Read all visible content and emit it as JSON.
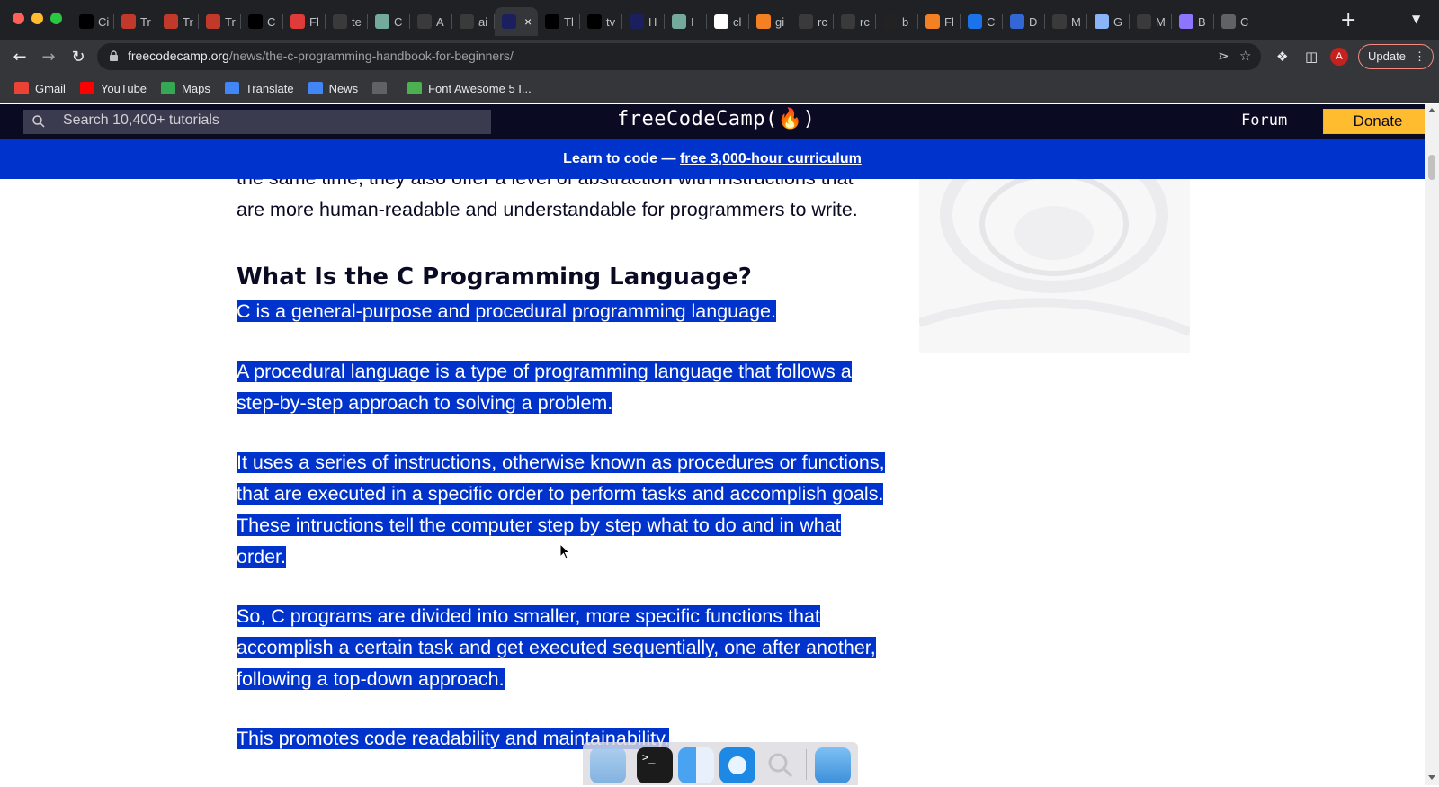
{
  "tabs": [
    {
      "title": "Ci",
      "icon": "terminal-icon",
      "color": "#000000"
    },
    {
      "title": "Tr",
      "icon": "red-square-icon",
      "color": "#c0392b"
    },
    {
      "title": "Tr",
      "icon": "red-square-icon",
      "color": "#c0392b"
    },
    {
      "title": "Tr",
      "icon": "red-square-icon",
      "color": "#c0392b"
    },
    {
      "title": "C",
      "icon": "terminal-icon",
      "color": "#000000"
    },
    {
      "title": "Fl",
      "icon": "target-icon",
      "color": "#e03b3b"
    },
    {
      "title": "te",
      "icon": "github-icon",
      "color": "#3a3a3a"
    },
    {
      "title": "C",
      "icon": "chatgpt-icon",
      "color": "#74aa9c"
    },
    {
      "title": "A",
      "icon": "github-icon",
      "color": "#3a3a3a"
    },
    {
      "title": "ai",
      "icon": "github-icon",
      "color": "#3a3a3a"
    },
    {
      "title": "",
      "icon": "lambda-icon",
      "color": "#1b1f5e",
      "active": true
    },
    {
      "title": "Tl",
      "icon": "terminal-icon",
      "color": "#000000"
    },
    {
      "title": "tv",
      "icon": "x-icon",
      "color": "#000000"
    },
    {
      "title": "H",
      "icon": "lambda-icon",
      "color": "#1b1f5e"
    },
    {
      "title": "I",
      "icon": "chatgpt-icon",
      "color": "#74aa9c"
    },
    {
      "title": "cl",
      "icon": "google-icon",
      "color": "#ffffff"
    },
    {
      "title": "gi",
      "icon": "stackoverflow-icon",
      "color": "#f48024"
    },
    {
      "title": "rc",
      "icon": "github-icon",
      "color": "#3a3a3a"
    },
    {
      "title": "rc",
      "icon": "github-icon",
      "color": "#3a3a3a"
    },
    {
      "title": "b",
      "icon": "paw-icon",
      "color": "#222222"
    },
    {
      "title": "Fl",
      "icon": "stackoverflow-icon",
      "color": "#f48024"
    },
    {
      "title": "C",
      "icon": "headset-icon",
      "color": "#1a73e8"
    },
    {
      "title": "D",
      "icon": "badge-icon",
      "color": "#3367d6"
    },
    {
      "title": "M",
      "icon": "github-icon",
      "color": "#3a3a3a"
    },
    {
      "title": "G",
      "icon": "book-icon",
      "color": "#8ab4f8"
    },
    {
      "title": "M",
      "icon": "github-icon",
      "color": "#3a3a3a"
    },
    {
      "title": "B",
      "icon": "sparkle-icon",
      "color": "#8e75ff"
    },
    {
      "title": "C",
      "icon": "globe-icon",
      "color": "#5f6368"
    }
  ],
  "toolbar": {
    "url_host": "freecodecamp.org",
    "url_path": "/news/the-c-programming-handbook-for-beginners/",
    "update_label": "Update",
    "avatar_letter": "A"
  },
  "bookmarks": [
    {
      "label": "Gmail",
      "icon": "gmail-icon",
      "color": "#ea4335"
    },
    {
      "label": "YouTube",
      "icon": "youtube-icon",
      "color": "#ff0000"
    },
    {
      "label": "Maps",
      "icon": "maps-icon",
      "color": "#34a853"
    },
    {
      "label": "Translate",
      "icon": "translate-icon",
      "color": "#4285f4"
    },
    {
      "label": "News",
      "icon": "news-icon",
      "color": "#4285f4"
    },
    {
      "label": "",
      "icon": "globe-icon",
      "color": "#5f6368"
    },
    {
      "label": "Font Awesome 5 I...",
      "icon": "w-icon",
      "color": "#4caf50"
    }
  ],
  "fcc": {
    "search_placeholder": "Search 10,400+ tutorials",
    "logo": "freeCodeCamp(🔥)",
    "forum": "Forum",
    "donate": "Donate",
    "banner_prefix": "Learn to code — ",
    "banner_link": "free 3,000-hour curriculum"
  },
  "article": {
    "prev_line1": "the same time, they also offer a level of abstraction with instructions that",
    "prev_line2": "are more human-readable and understandable for programmers to write.",
    "heading": "What Is the C Programming Language?",
    "p1": [
      "C is a general-purpose and procedural programming language."
    ],
    "p2": [
      "A procedural language is a type of programming language that follows a",
      "step-by-step approach to solving a problem."
    ],
    "p3": [
      "It uses a series of instructions, otherwise known as procedures or functions,",
      "that are executed in a specific order to perform tasks and accomplish goals.",
      "These intructions tell the computer step by step what to do and in what",
      "order."
    ],
    "p4": [
      "So, C programs are divided into smaller, more specific functions that",
      "accomplish a certain task and get executed sequentially, one after another,",
      "following a top-down approach."
    ],
    "p5": [
      "This promotes code readability and maintainability."
    ]
  },
  "colors": {
    "selection": "#0033cc",
    "fcc_nav": "#0a0a23",
    "donate": "#febc2e"
  },
  "dock": [
    {
      "icon": "desktop-folder-icon"
    },
    {
      "icon": "terminal-icon"
    },
    {
      "icon": "finder-icon"
    },
    {
      "icon": "safari-icon"
    },
    {
      "icon": "search-icon"
    },
    {
      "icon": "folder-icon"
    }
  ]
}
